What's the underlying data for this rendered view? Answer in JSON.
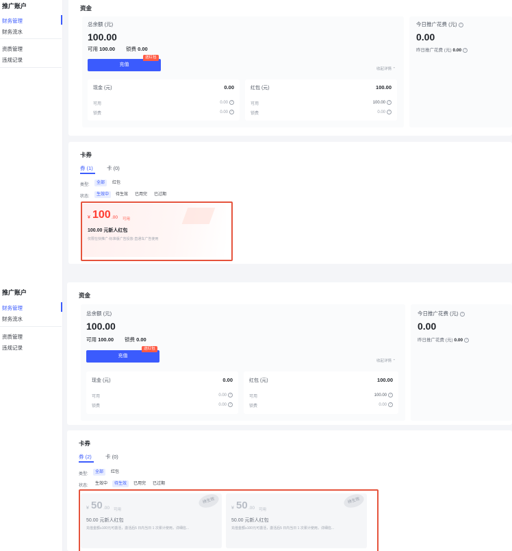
{
  "sidebar": {
    "title": "推广账户",
    "items": [
      {
        "label": "财务管理",
        "active": true
      },
      {
        "label": "财务流水",
        "active": false
      },
      {
        "label": "资质管理",
        "active": false
      },
      {
        "label": "违规记录",
        "active": false
      }
    ]
  },
  "funds": {
    "section_title": "资金",
    "total_label": "总余额 (元)",
    "total_value": "100.00",
    "available_label": "可用",
    "available_value": "100.00",
    "locked_label": "锁费",
    "locked_value": "0.00",
    "recharge_label": "充值",
    "recharge_badge": "送红包",
    "collapse_label": "收起详情",
    "cash": {
      "title": "现金 (元)",
      "value": "0.00",
      "rows": [
        {
          "label": "可用",
          "value": "0.00"
        },
        {
          "label": "锁费",
          "value": "0.00"
        }
      ]
    },
    "redpacket": {
      "title": "红包 (元)",
      "value": "100.00",
      "rows": [
        {
          "label": "可用",
          "value": "100.00"
        },
        {
          "label": "锁费",
          "value": "0.00"
        }
      ]
    },
    "today_label": "今日推广花费 (元)",
    "today_value": "0.00",
    "yesterday_label": "昨日推广花费 (元)",
    "yesterday_value": "0.00"
  },
  "coupons_screen1": {
    "section_title": "卡券",
    "tab_coupon": "券 (1)",
    "tab_card": "卡 (0)",
    "type_label": "类型:",
    "type_options": [
      "全部",
      "红包"
    ],
    "status_label": "状态:",
    "status_options": [
      "生效中",
      "待生效",
      "已用完",
      "已过期"
    ],
    "active_status": 0,
    "coupons": [
      {
        "currency": "¥",
        "amount": "100",
        "cents": ".00",
        "avail": "可用",
        "name": "100.00 元新人红包",
        "desc": "仅限在快推广-标准版广告投放-直通车广告使用",
        "stamp": ""
      }
    ]
  },
  "coupons_screen2": {
    "section_title": "卡券",
    "tab_coupon": "券 (2)",
    "tab_card": "卡 (0)",
    "type_label": "类型:",
    "type_options": [
      "全部",
      "红包"
    ],
    "status_label": "状态:",
    "status_options": [
      "生效中",
      "待生效",
      "已用完",
      "已过期"
    ],
    "active_status": 1,
    "coupons": [
      {
        "currency": "¥",
        "amount": "50",
        "cents": ".00",
        "avail": "可用",
        "name": "50.00 元新人红包",
        "desc": "充值金额≥100元可激活，激活后5 日内当日 1 次累计使用，详细信...",
        "stamp": "待生效"
      },
      {
        "currency": "¥",
        "amount": "50",
        "cents": ".00",
        "avail": "可用",
        "name": "50.00 元新人红包",
        "desc": "充值金额≥100元可激活，激活后5 日内当日 1 次累计使用，详细信...",
        "stamp": "待生效"
      }
    ]
  },
  "colors": {
    "accent": "#3b5bfd",
    "highlight": "#e5523b",
    "coupon_red": "#ff3b30"
  }
}
